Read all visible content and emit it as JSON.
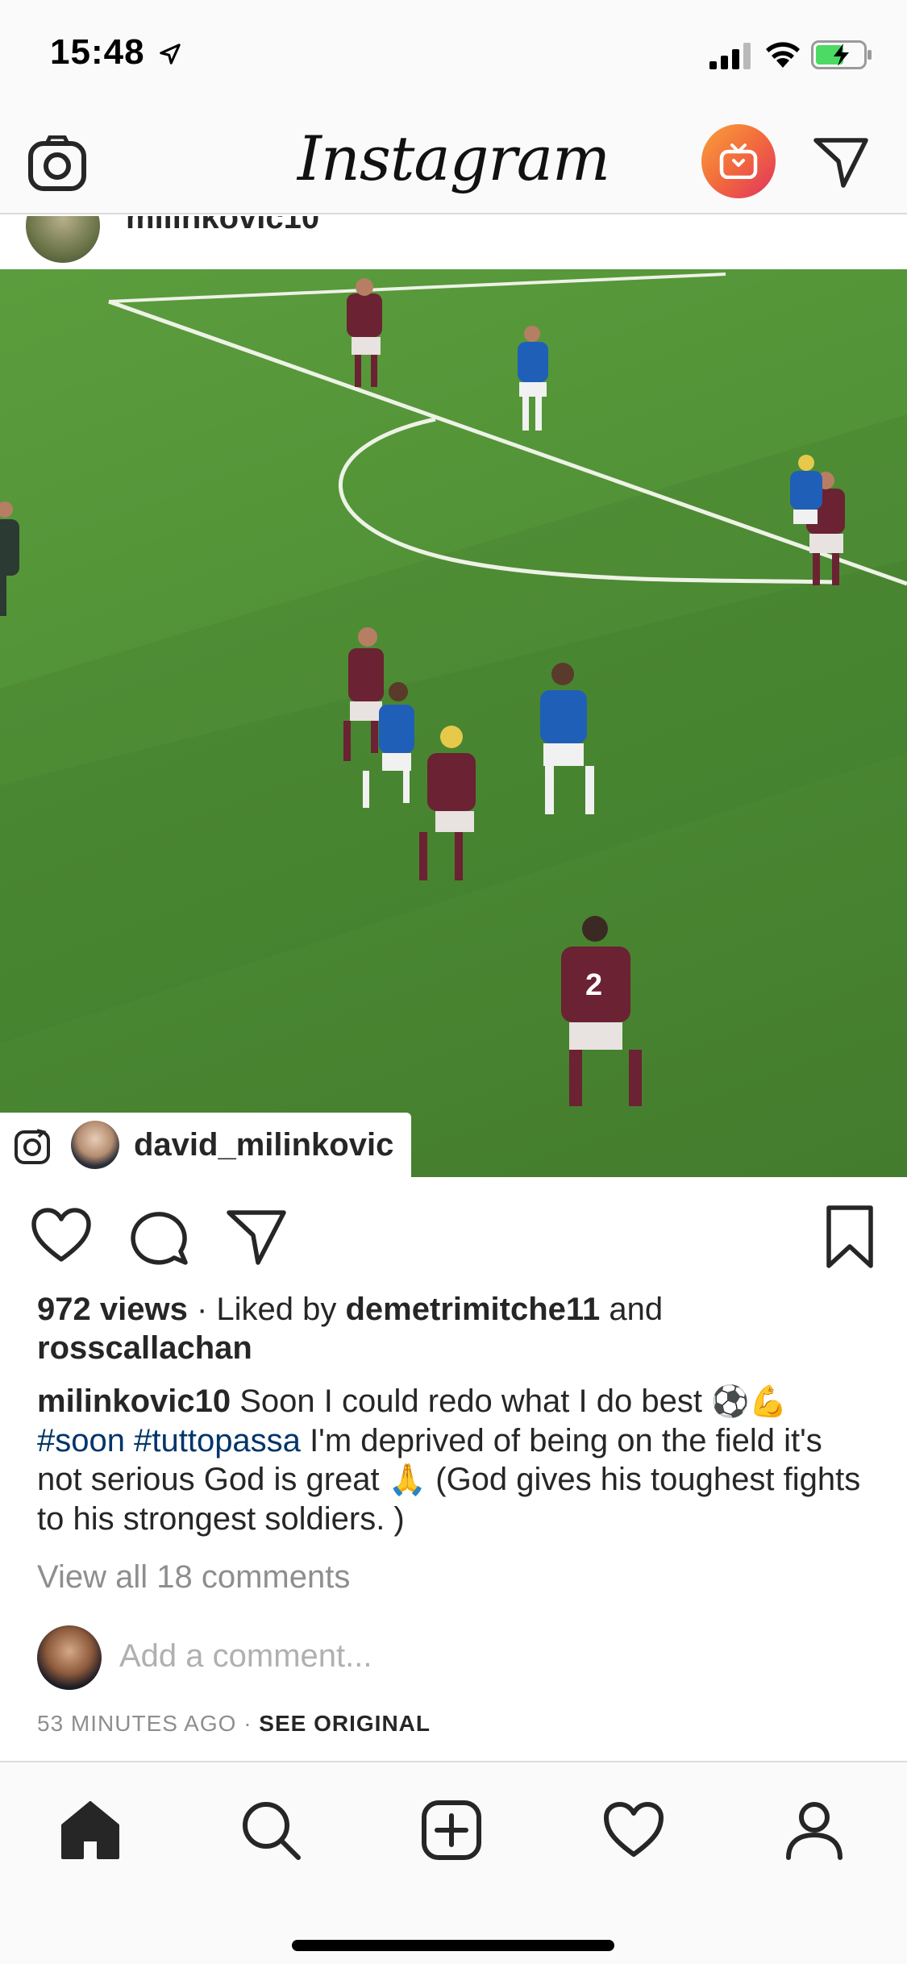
{
  "status": {
    "time": "15:48"
  },
  "header": {
    "logo": "Instagram"
  },
  "previous_post": {
    "username": "milinkovic10"
  },
  "post": {
    "attribution_username": "david_milinkovic",
    "views": "972 views",
    "liked_by_prefix": "· Liked by",
    "liked_by_user1": "demetrimitche11",
    "liked_by_and": "and",
    "liked_by_user2": "rosscallachan",
    "caption_user": "milinkovic10",
    "caption_text1": "Soon I could redo what I do best",
    "caption_emoji1": "⚽",
    "caption_emoji2": "💪",
    "hashtag1": "#soon",
    "hashtag2": "#tuttopassa",
    "caption_text2": "I'm deprived of being on the field it's not serious God is great",
    "caption_emoji3": "🙏",
    "caption_text3": "(God gives his toughest fights to his strongest soldiers. )",
    "view_comments": "View all 18 comments",
    "comment_placeholder": "Add a comment...",
    "time_ago": "53 MINUTES AGO",
    "separator": "·",
    "see_original": "SEE ORIGINAL"
  },
  "colors": {
    "hashtag": "#003569",
    "muted": "#8e8e8e",
    "pitch": "#4f8d35",
    "igtv_start": "#f9a13a",
    "igtv_end": "#e0325f"
  },
  "icons": {
    "header": [
      "camera-icon",
      "igtv-icon",
      "direct-message-icon"
    ],
    "actions": [
      "heart-icon",
      "comment-icon",
      "share-icon",
      "bookmark-icon"
    ],
    "tabs": [
      "home-icon",
      "search-icon",
      "add-post-icon",
      "activity-heart-icon",
      "profile-icon"
    ]
  }
}
